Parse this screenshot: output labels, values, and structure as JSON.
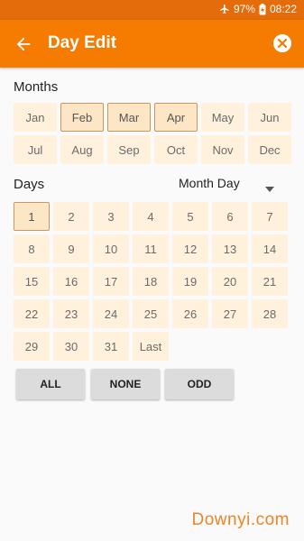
{
  "status": {
    "battery": "97%",
    "time": "08:22"
  },
  "appbar": {
    "title": "Day Edit"
  },
  "months": {
    "label": "Months",
    "items": [
      {
        "label": "Jan",
        "selected": false
      },
      {
        "label": "Feb",
        "selected": true
      },
      {
        "label": "Mar",
        "selected": true
      },
      {
        "label": "Apr",
        "selected": true
      },
      {
        "label": "May",
        "selected": false
      },
      {
        "label": "Jun",
        "selected": false
      },
      {
        "label": "Jul",
        "selected": false
      },
      {
        "label": "Aug",
        "selected": false
      },
      {
        "label": "Sep",
        "selected": false
      },
      {
        "label": "Oct",
        "selected": false
      },
      {
        "label": "Nov",
        "selected": false
      },
      {
        "label": "Dec",
        "selected": false
      }
    ]
  },
  "days": {
    "label": "Days",
    "mode": "Month Day",
    "items": [
      {
        "label": "1",
        "selected": true
      },
      {
        "label": "2",
        "selected": false
      },
      {
        "label": "3",
        "selected": false
      },
      {
        "label": "4",
        "selected": false
      },
      {
        "label": "5",
        "selected": false
      },
      {
        "label": "6",
        "selected": false
      },
      {
        "label": "7",
        "selected": false
      },
      {
        "label": "8",
        "selected": false
      },
      {
        "label": "9",
        "selected": false
      },
      {
        "label": "10",
        "selected": false
      },
      {
        "label": "11",
        "selected": false
      },
      {
        "label": "12",
        "selected": false
      },
      {
        "label": "13",
        "selected": false
      },
      {
        "label": "14",
        "selected": false
      },
      {
        "label": "15",
        "selected": false
      },
      {
        "label": "16",
        "selected": false
      },
      {
        "label": "17",
        "selected": false
      },
      {
        "label": "18",
        "selected": false
      },
      {
        "label": "19",
        "selected": false
      },
      {
        "label": "20",
        "selected": false
      },
      {
        "label": "21",
        "selected": false
      },
      {
        "label": "22",
        "selected": false
      },
      {
        "label": "23",
        "selected": false
      },
      {
        "label": "24",
        "selected": false
      },
      {
        "label": "25",
        "selected": false
      },
      {
        "label": "26",
        "selected": false
      },
      {
        "label": "27",
        "selected": false
      },
      {
        "label": "28",
        "selected": false
      },
      {
        "label": "29",
        "selected": false
      },
      {
        "label": "30",
        "selected": false
      },
      {
        "label": "31",
        "selected": false
      },
      {
        "label": "Last",
        "selected": false
      }
    ]
  },
  "buttons": {
    "all": "ALL",
    "none": "NONE",
    "odd": "ODD"
  },
  "watermark": "Downyi.com",
  "colors": {
    "appbar": "#f57c00",
    "statusbar": "#e46c0a",
    "cell": "#fff1dc",
    "selected_border": "#c9975e"
  }
}
